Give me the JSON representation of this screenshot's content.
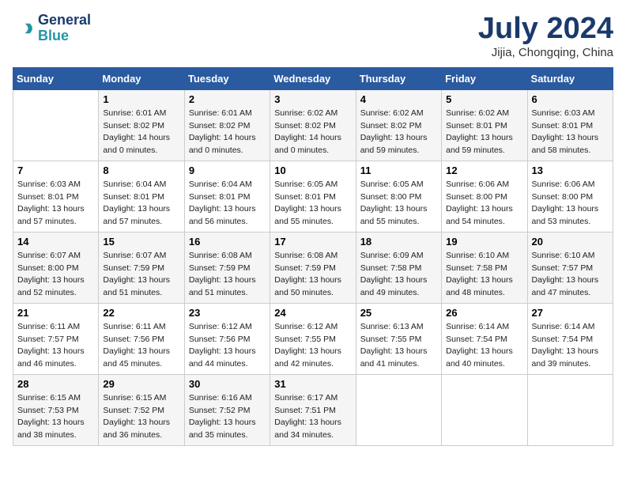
{
  "logo": {
    "line1": "General",
    "line2": "Blue"
  },
  "title": "July 2024",
  "subtitle": "Jijia, Chongqing, China",
  "days_header": [
    "Sunday",
    "Monday",
    "Tuesday",
    "Wednesday",
    "Thursday",
    "Friday",
    "Saturday"
  ],
  "weeks": [
    [
      {
        "day": "",
        "sunrise": "",
        "sunset": "",
        "daylight": ""
      },
      {
        "day": "1",
        "sunrise": "Sunrise: 6:01 AM",
        "sunset": "Sunset: 8:02 PM",
        "daylight": "Daylight: 14 hours and 0 minutes."
      },
      {
        "day": "2",
        "sunrise": "Sunrise: 6:01 AM",
        "sunset": "Sunset: 8:02 PM",
        "daylight": "Daylight: 14 hours and 0 minutes."
      },
      {
        "day": "3",
        "sunrise": "Sunrise: 6:02 AM",
        "sunset": "Sunset: 8:02 PM",
        "daylight": "Daylight: 14 hours and 0 minutes."
      },
      {
        "day": "4",
        "sunrise": "Sunrise: 6:02 AM",
        "sunset": "Sunset: 8:02 PM",
        "daylight": "Daylight: 13 hours and 59 minutes."
      },
      {
        "day": "5",
        "sunrise": "Sunrise: 6:02 AM",
        "sunset": "Sunset: 8:01 PM",
        "daylight": "Daylight: 13 hours and 59 minutes."
      },
      {
        "day": "6",
        "sunrise": "Sunrise: 6:03 AM",
        "sunset": "Sunset: 8:01 PM",
        "daylight": "Daylight: 13 hours and 58 minutes."
      }
    ],
    [
      {
        "day": "7",
        "sunrise": "Sunrise: 6:03 AM",
        "sunset": "Sunset: 8:01 PM",
        "daylight": "Daylight: 13 hours and 57 minutes."
      },
      {
        "day": "8",
        "sunrise": "Sunrise: 6:04 AM",
        "sunset": "Sunset: 8:01 PM",
        "daylight": "Daylight: 13 hours and 57 minutes."
      },
      {
        "day": "9",
        "sunrise": "Sunrise: 6:04 AM",
        "sunset": "Sunset: 8:01 PM",
        "daylight": "Daylight: 13 hours and 56 minutes."
      },
      {
        "day": "10",
        "sunrise": "Sunrise: 6:05 AM",
        "sunset": "Sunset: 8:01 PM",
        "daylight": "Daylight: 13 hours and 55 minutes."
      },
      {
        "day": "11",
        "sunrise": "Sunrise: 6:05 AM",
        "sunset": "Sunset: 8:00 PM",
        "daylight": "Daylight: 13 hours and 55 minutes."
      },
      {
        "day": "12",
        "sunrise": "Sunrise: 6:06 AM",
        "sunset": "Sunset: 8:00 PM",
        "daylight": "Daylight: 13 hours and 54 minutes."
      },
      {
        "day": "13",
        "sunrise": "Sunrise: 6:06 AM",
        "sunset": "Sunset: 8:00 PM",
        "daylight": "Daylight: 13 hours and 53 minutes."
      }
    ],
    [
      {
        "day": "14",
        "sunrise": "Sunrise: 6:07 AM",
        "sunset": "Sunset: 8:00 PM",
        "daylight": "Daylight: 13 hours and 52 minutes."
      },
      {
        "day": "15",
        "sunrise": "Sunrise: 6:07 AM",
        "sunset": "Sunset: 7:59 PM",
        "daylight": "Daylight: 13 hours and 51 minutes."
      },
      {
        "day": "16",
        "sunrise": "Sunrise: 6:08 AM",
        "sunset": "Sunset: 7:59 PM",
        "daylight": "Daylight: 13 hours and 51 minutes."
      },
      {
        "day": "17",
        "sunrise": "Sunrise: 6:08 AM",
        "sunset": "Sunset: 7:59 PM",
        "daylight": "Daylight: 13 hours and 50 minutes."
      },
      {
        "day": "18",
        "sunrise": "Sunrise: 6:09 AM",
        "sunset": "Sunset: 7:58 PM",
        "daylight": "Daylight: 13 hours and 49 minutes."
      },
      {
        "day": "19",
        "sunrise": "Sunrise: 6:10 AM",
        "sunset": "Sunset: 7:58 PM",
        "daylight": "Daylight: 13 hours and 48 minutes."
      },
      {
        "day": "20",
        "sunrise": "Sunrise: 6:10 AM",
        "sunset": "Sunset: 7:57 PM",
        "daylight": "Daylight: 13 hours and 47 minutes."
      }
    ],
    [
      {
        "day": "21",
        "sunrise": "Sunrise: 6:11 AM",
        "sunset": "Sunset: 7:57 PM",
        "daylight": "Daylight: 13 hours and 46 minutes."
      },
      {
        "day": "22",
        "sunrise": "Sunrise: 6:11 AM",
        "sunset": "Sunset: 7:56 PM",
        "daylight": "Daylight: 13 hours and 45 minutes."
      },
      {
        "day": "23",
        "sunrise": "Sunrise: 6:12 AM",
        "sunset": "Sunset: 7:56 PM",
        "daylight": "Daylight: 13 hours and 44 minutes."
      },
      {
        "day": "24",
        "sunrise": "Sunrise: 6:12 AM",
        "sunset": "Sunset: 7:55 PM",
        "daylight": "Daylight: 13 hours and 42 minutes."
      },
      {
        "day": "25",
        "sunrise": "Sunrise: 6:13 AM",
        "sunset": "Sunset: 7:55 PM",
        "daylight": "Daylight: 13 hours and 41 minutes."
      },
      {
        "day": "26",
        "sunrise": "Sunrise: 6:14 AM",
        "sunset": "Sunset: 7:54 PM",
        "daylight": "Daylight: 13 hours and 40 minutes."
      },
      {
        "day": "27",
        "sunrise": "Sunrise: 6:14 AM",
        "sunset": "Sunset: 7:54 PM",
        "daylight": "Daylight: 13 hours and 39 minutes."
      }
    ],
    [
      {
        "day": "28",
        "sunrise": "Sunrise: 6:15 AM",
        "sunset": "Sunset: 7:53 PM",
        "daylight": "Daylight: 13 hours and 38 minutes."
      },
      {
        "day": "29",
        "sunrise": "Sunrise: 6:15 AM",
        "sunset": "Sunset: 7:52 PM",
        "daylight": "Daylight: 13 hours and 36 minutes."
      },
      {
        "day": "30",
        "sunrise": "Sunrise: 6:16 AM",
        "sunset": "Sunset: 7:52 PM",
        "daylight": "Daylight: 13 hours and 35 minutes."
      },
      {
        "day": "31",
        "sunrise": "Sunrise: 6:17 AM",
        "sunset": "Sunset: 7:51 PM",
        "daylight": "Daylight: 13 hours and 34 minutes."
      },
      {
        "day": "",
        "sunrise": "",
        "sunset": "",
        "daylight": ""
      },
      {
        "day": "",
        "sunrise": "",
        "sunset": "",
        "daylight": ""
      },
      {
        "day": "",
        "sunrise": "",
        "sunset": "",
        "daylight": ""
      }
    ]
  ]
}
